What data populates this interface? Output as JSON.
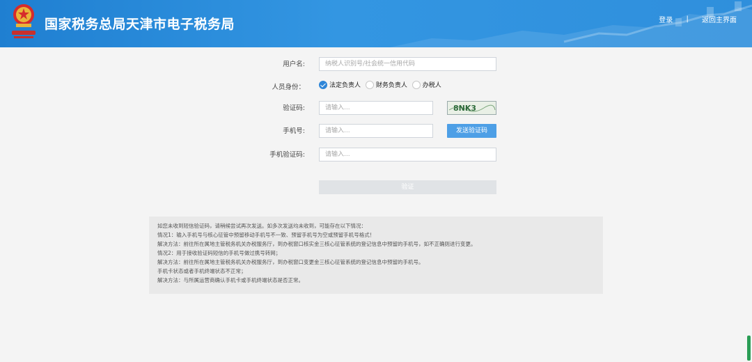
{
  "header": {
    "title": "国家税务总局天津市电子税务局",
    "nav": {
      "login": "登录",
      "separator": "|",
      "home": "返回主界面"
    }
  },
  "form": {
    "username": {
      "label": "用户名:",
      "placeholder": "纳税人识别号/社会统一信用代码",
      "value": ""
    },
    "identity": {
      "label": "人员身份：",
      "options": [
        {
          "label": "法定负责人",
          "selected": true
        },
        {
          "label": "财务负责人",
          "selected": false
        },
        {
          "label": "办税人",
          "selected": false
        }
      ]
    },
    "captcha": {
      "label": "验证码:",
      "placeholder": "请输入...",
      "image_text": "8NK3"
    },
    "phone": {
      "label": "手机号:",
      "placeholder": "请输入...",
      "send_button": "发送验证码"
    },
    "sms_code": {
      "label": "手机验证码:",
      "placeholder": "请输入..."
    },
    "verify_button": "验证"
  },
  "notice": {
    "lines": [
      "如您未收到短信验证码，请稍候尝试再次发送。如多次发送均未收到，可能存在以下情况：",
      "情况1：输入手机号与核心征管中预留移动手机号不一致、预留手机号为空或预留手机号格式！",
      "解决方法：前往所在属地主管税务机关办税服务厅，到办税窗口核实金三核心征管系统的登记信息中预留的手机号，如不正确则进行变更。",
      "情况2：用于接收验证码短信的手机号做过携号转网；",
      "解决方法：前往所在属地主管税务机关办税服务厅，到办税窗口变更金三核心征管系统的登记信息中预留的手机号。",
      "手机卡状态或者手机终端状态不正常；",
      "解决方法：与所属运营商确认手机卡或手机终端状态是否正常。"
    ]
  },
  "colors": {
    "header_blue": "#2f8fdc",
    "primary_button": "#4d9fe6",
    "disabled_button": "#e0e3e6",
    "radio_checked": "#2f86d8"
  },
  "icons": {
    "emblem": "national-tax-emblem-icon",
    "radio_checked": "checkmark-icon"
  }
}
